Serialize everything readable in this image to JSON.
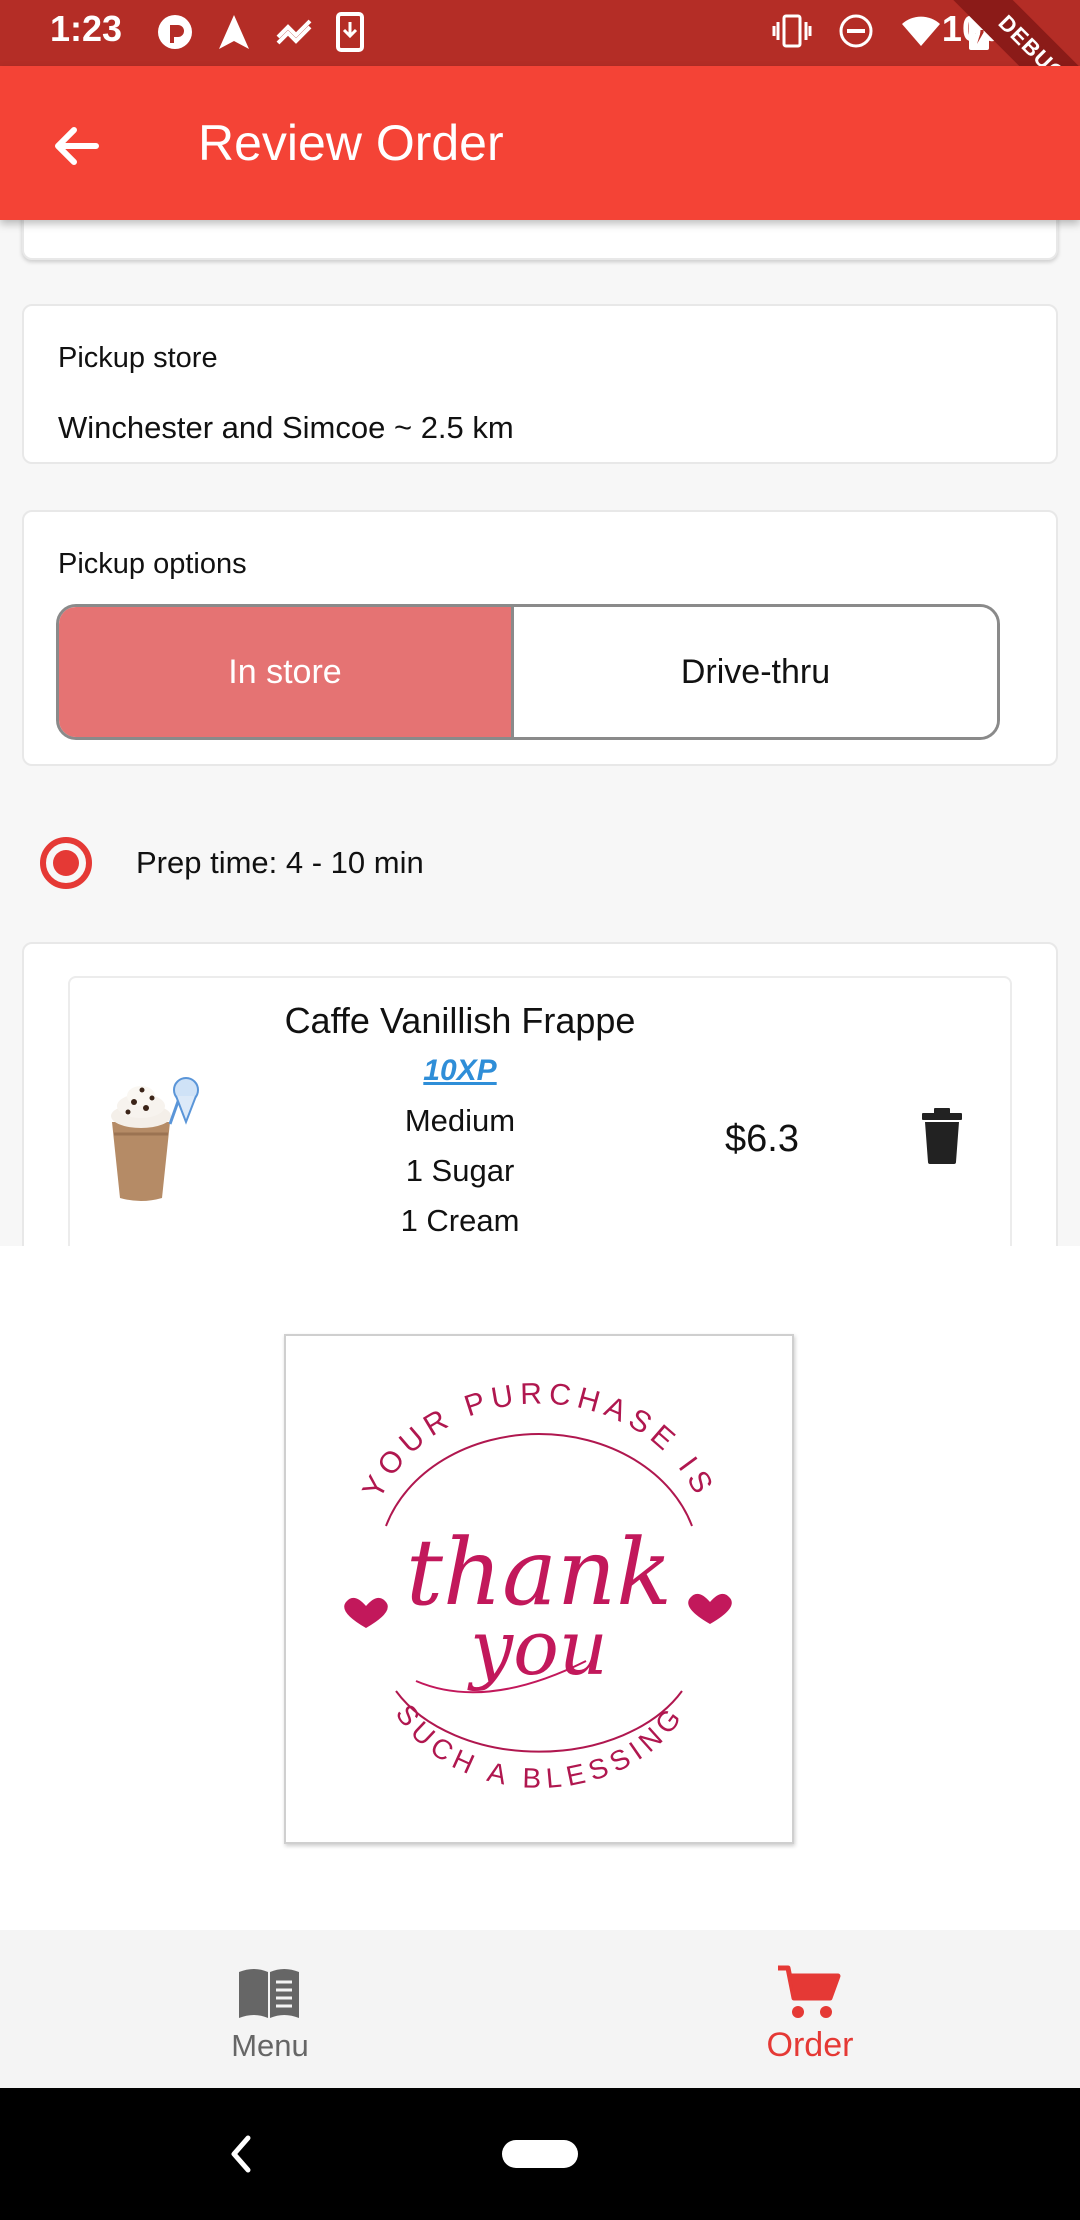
{
  "status_bar": {
    "time": "1:23",
    "battery": "100%",
    "debug_label": "DEBUG",
    "icons_left": [
      "sync-icon",
      "navigation-icon",
      "link-icon",
      "download-icon"
    ],
    "icons_right": [
      "vibrate-icon",
      "dnd-icon",
      "wifi-icon",
      "battery-icon"
    ]
  },
  "app_bar": {
    "title": "Review Order",
    "back_icon": "arrow-back-icon",
    "color": "#f44336"
  },
  "pickup_store": {
    "label": "Pickup store",
    "value": "Winchester and Simcoe ~ 2.5 km"
  },
  "pickup_options": {
    "label": "Pickup options",
    "options": [
      "In store",
      "Drive-thru"
    ],
    "selected": "In store",
    "selected_color": "#e57373"
  },
  "prep": {
    "text": "Prep time: 4 - 10 min",
    "radio_color": "#e53935"
  },
  "order_item": {
    "name": "Caffe Vanillish Frappe",
    "xp": "10XP",
    "size": "Medium",
    "sugar": "1 Sugar",
    "cream": "1 Cream",
    "price": "$6.3",
    "delete_icon": "trash-icon"
  },
  "thank_you_image": {
    "top_arc": "YOUR PURCHASE IS",
    "script_line1": "thank",
    "script_line2": "you",
    "bottom_arc": "SUCH A BLESSING",
    "color": "#c2185b"
  },
  "bottom_nav": {
    "items": [
      {
        "label": "Menu",
        "icon": "book-icon",
        "active": false
      },
      {
        "label": "Order",
        "icon": "cart-icon",
        "active": true
      }
    ],
    "active_color": "#e53935"
  },
  "system_nav": {
    "back_icon": "chevron-left-icon",
    "home_icon": "home-pill-icon"
  }
}
